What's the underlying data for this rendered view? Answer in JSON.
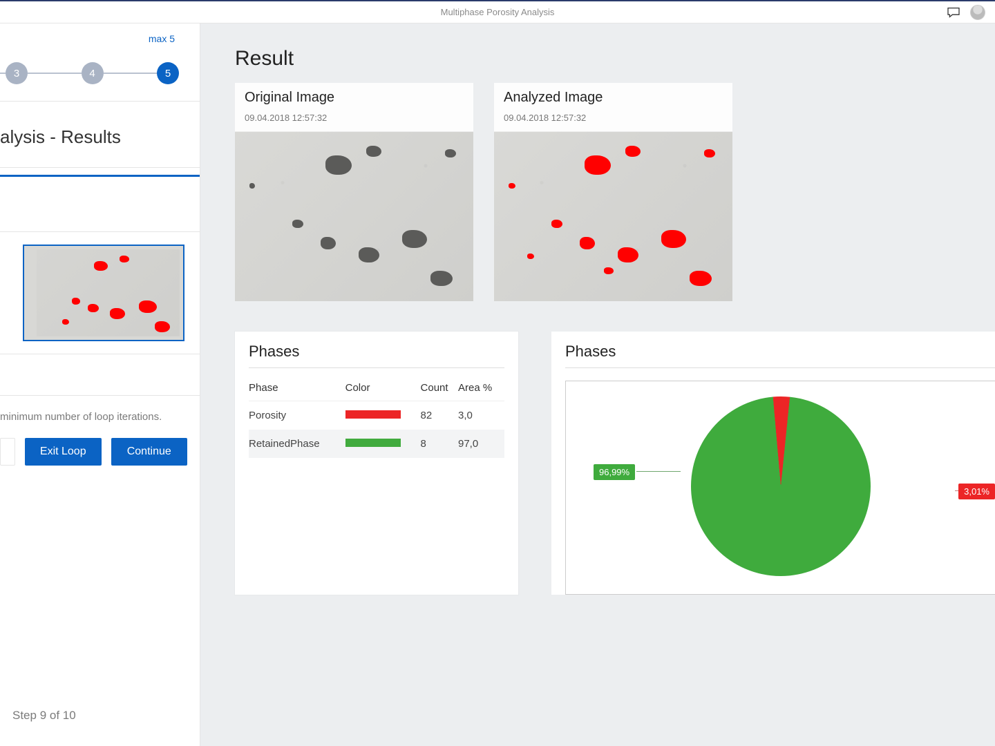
{
  "topbar": {
    "title": "Multiphase Porosity Analysis"
  },
  "stepper": {
    "max_label": "max 5",
    "steps": [
      "3",
      "4",
      "5"
    ],
    "active_index": 2
  },
  "sidebar": {
    "section_title": "alysis - Results",
    "hint": "minimum number of loop iterations.",
    "buttons": {
      "exit": "Exit Loop",
      "continue": "Continue"
    },
    "footer": "Step 9 of 10"
  },
  "result": {
    "title": "Result",
    "cards": [
      {
        "title": "Original Image",
        "timestamp": "09.04.2018 12:57:32"
      },
      {
        "title": "Analyzed Image",
        "timestamp": "09.04.2018 12:57:32"
      }
    ]
  },
  "phases_table": {
    "title": "Phases",
    "headers": [
      "Phase",
      "Color",
      "Count",
      "Area %"
    ],
    "rows": [
      {
        "name": "Porosity",
        "color": "#ec2526",
        "count": "82",
        "area": "3,0"
      },
      {
        "name": "RetainedPhase",
        "color": "#41ab3e",
        "count": "8",
        "area": "97,0"
      }
    ]
  },
  "phases_chart": {
    "title": "Phases",
    "labels": {
      "green": "96,99%",
      "red": "3,01%"
    }
  },
  "chart_data": {
    "type": "pie",
    "title": "Phases",
    "series": [
      {
        "name": "RetainedPhase",
        "value": 96.99,
        "color": "#3fab3d"
      },
      {
        "name": "Porosity",
        "value": 3.01,
        "color": "#ec2526"
      }
    ]
  }
}
